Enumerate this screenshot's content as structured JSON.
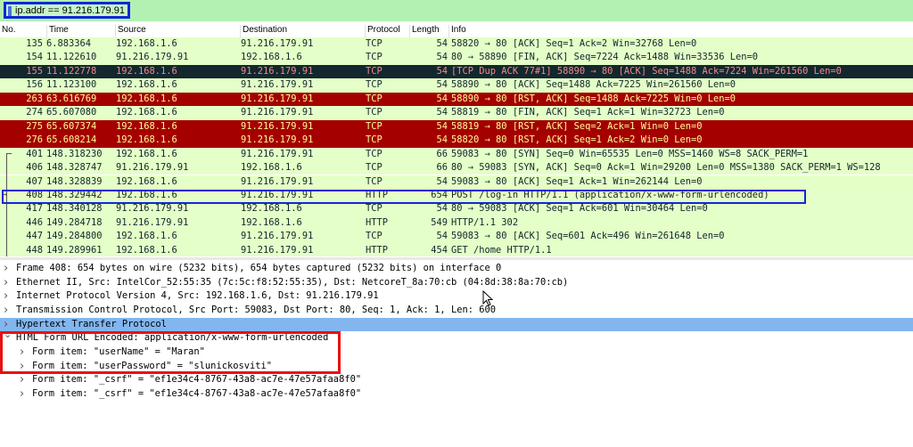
{
  "filter": {
    "text": "ip.addr == 91.216.179.91"
  },
  "columns": [
    "No.",
    "Time",
    "Source",
    "Destination",
    "Protocol",
    "Length",
    "Info"
  ],
  "packets": [
    {
      "no": "135",
      "time": "6.883364",
      "src": "192.168.1.6",
      "dst": "91.216.179.91",
      "proto": "TCP",
      "len": "54",
      "info": "58820 → 80 [ACK] Seq=1 Ack=2 Win=32768 Len=0",
      "style": "green"
    },
    {
      "no": "154",
      "time": "11.122610",
      "src": "91.216.179.91",
      "dst": "192.168.1.6",
      "proto": "TCP",
      "len": "54",
      "info": "80 → 58890 [FIN, ACK] Seq=7224 Ack=1488 Win=33536 Len=0",
      "style": "green"
    },
    {
      "no": "155",
      "time": "11.122778",
      "src": "192.168.1.6",
      "dst": "91.216.179.91",
      "proto": "TCP",
      "len": "54",
      "info": "[TCP Dup ACK 77#1] 58890 → 80 [ACK] Seq=1488 Ack=7224 Win=261560 Len=0",
      "style": "dark"
    },
    {
      "no": "156",
      "time": "11.123100",
      "src": "192.168.1.6",
      "dst": "91.216.179.91",
      "proto": "TCP",
      "len": "54",
      "info": "58890 → 80 [ACK] Seq=1488 Ack=7225 Win=261560 Len=0",
      "style": "green"
    },
    {
      "no": "263",
      "time": "63.616769",
      "src": "192.168.1.6",
      "dst": "91.216.179.91",
      "proto": "TCP",
      "len": "54",
      "info": "58890 → 80 [RST, ACK] Seq=1488 Ack=7225 Win=0 Len=0",
      "style": "red"
    },
    {
      "no": "274",
      "time": "65.607080",
      "src": "192.168.1.6",
      "dst": "91.216.179.91",
      "proto": "TCP",
      "len": "54",
      "info": "58819 → 80 [FIN, ACK] Seq=1 Ack=1 Win=32723 Len=0",
      "style": "green"
    },
    {
      "no": "275",
      "time": "65.607374",
      "src": "192.168.1.6",
      "dst": "91.216.179.91",
      "proto": "TCP",
      "len": "54",
      "info": "58819 → 80 [RST, ACK] Seq=2 Ack=1 Win=0 Len=0",
      "style": "red"
    },
    {
      "no": "276",
      "time": "65.608214",
      "src": "192.168.1.6",
      "dst": "91.216.179.91",
      "proto": "TCP",
      "len": "54",
      "info": "58820 → 80 [RST, ACK] Seq=1 Ack=2 Win=0 Len=0",
      "style": "red"
    },
    {
      "no": "401",
      "time": "148.318230",
      "src": "192.168.1.6",
      "dst": "91.216.179.91",
      "proto": "TCP",
      "len": "66",
      "info": "59083 → 80 [SYN] Seq=0 Win=65535 Len=0 MSS=1460 WS=8 SACK_PERM=1",
      "style": "green"
    },
    {
      "no": "406",
      "time": "148.328747",
      "src": "91.216.179.91",
      "dst": "192.168.1.6",
      "proto": "TCP",
      "len": "66",
      "info": "80 → 59083 [SYN, ACK] Seq=0 Ack=1 Win=29200 Len=0 MSS=1380 SACK_PERM=1 WS=128",
      "style": "green"
    },
    {
      "no": "407",
      "time": "148.328839",
      "src": "192.168.1.6",
      "dst": "91.216.179.91",
      "proto": "TCP",
      "len": "54",
      "info": "59083 → 80 [ACK] Seq=1 Ack=1 Win=262144 Len=0",
      "style": "green"
    },
    {
      "no": "408",
      "time": "148.329442",
      "src": "192.168.1.6",
      "dst": "91.216.179.91",
      "proto": "HTTP",
      "len": "654",
      "info": "POST /log-in HTTP/1.1  (application/x-www-form-urlencoded)",
      "style": "selected"
    },
    {
      "no": "417",
      "time": "148.340128",
      "src": "91.216.179.91",
      "dst": "192.168.1.6",
      "proto": "TCP",
      "len": "54",
      "info": "80 → 59083 [ACK] Seq=1 Ack=601 Win=30464 Len=0",
      "style": "green"
    },
    {
      "no": "446",
      "time": "149.284718",
      "src": "91.216.179.91",
      "dst": "192.168.1.6",
      "proto": "HTTP",
      "len": "549",
      "info": "HTTP/1.1 302",
      "style": "http"
    },
    {
      "no": "447",
      "time": "149.284800",
      "src": "192.168.1.6",
      "dst": "91.216.179.91",
      "proto": "TCP",
      "len": "54",
      "info": "59083 → 80 [ACK] Seq=601 Ack=496 Win=261648 Len=0",
      "style": "green"
    },
    {
      "no": "448",
      "time": "149.289961",
      "src": "192.168.1.6",
      "dst": "91.216.179.91",
      "proto": "HTTP",
      "len": "454",
      "info": "GET /home HTTP/1.1",
      "style": "http"
    }
  ],
  "details": [
    {
      "text": "Frame 408: 654 bytes on wire (5232 bits), 654 bytes captured (5232 bits) on interface 0",
      "level": 0,
      "expanded": false,
      "highlight": false
    },
    {
      "text": "Ethernet II, Src: IntelCor_52:55:35 (7c:5c:f8:52:55:35), Dst: NetcoreT_8a:70:cb (04:8d:38:8a:70:cb)",
      "level": 0,
      "expanded": false,
      "highlight": false
    },
    {
      "text": "Internet Protocol Version 4, Src: 192.168.1.6, Dst: 91.216.179.91",
      "level": 0,
      "expanded": false,
      "highlight": false
    },
    {
      "text": "Transmission Control Protocol, Src Port: 59083, Dst Port: 80, Seq: 1, Ack: 1, Len: 600",
      "level": 0,
      "expanded": false,
      "highlight": false
    },
    {
      "text": "Hypertext Transfer Protocol",
      "level": 0,
      "expanded": false,
      "highlight": true
    },
    {
      "text": "HTML Form URL Encoded: application/x-www-form-urlencoded",
      "level": 0,
      "expanded": true,
      "highlight": false
    },
    {
      "text": "Form item: \"userName\" = \"Maran\"",
      "level": 1,
      "expanded": false,
      "highlight": false
    },
    {
      "text": "Form item: \"userPassword\" = \"slunickosviti\"",
      "level": 1,
      "expanded": false,
      "highlight": false
    },
    {
      "text": "Form item: \"_csrf\" = \"ef1e34c4-8767-43a8-ac7e-47e57afaa8f0\"",
      "level": 1,
      "expanded": false,
      "highlight": false
    },
    {
      "text": "Form item: \"_csrf\" = \"ef1e34c4-8767-43a8-ac7e-47e57afaa8f0\"",
      "level": 1,
      "expanded": false,
      "highlight": false
    }
  ],
  "icons": {
    "collapsed": "chevron-right-icon",
    "expanded": "chevron-down-icon",
    "cursor": "mouse-pointer-icon"
  }
}
